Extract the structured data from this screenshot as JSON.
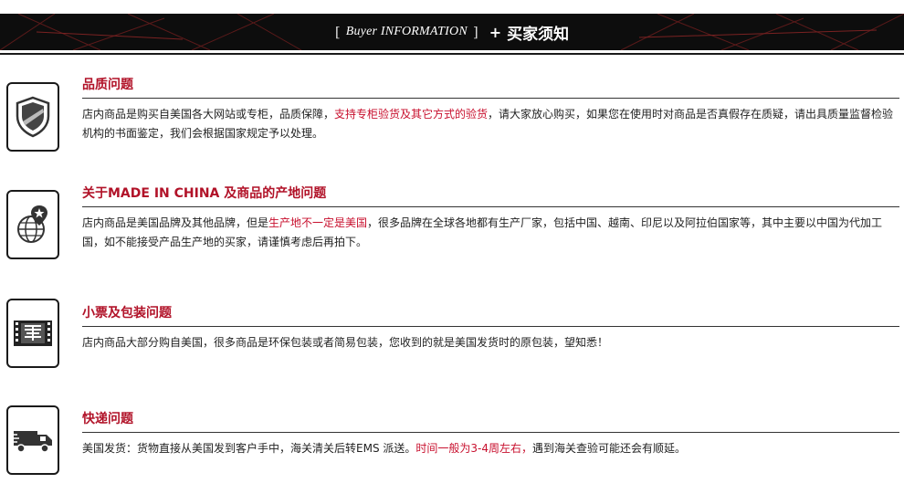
{
  "header": {
    "bracket_open": "[",
    "title_en": "Buyer INFORMATION",
    "bracket_close": "]",
    "plus": "+",
    "title_cn": "买家须知"
  },
  "colors": {
    "accent": "#b11228",
    "highlight": "#c8102e",
    "banner": "#0d0d0d"
  },
  "sections": [
    {
      "icon": "shield-icon",
      "title": "品质问题",
      "body_before": "店内商品是购买自美国各大网站或专柜，品质保障，",
      "body_highlight": "支持专柜验货及其它方式的验货",
      "body_after": "，请大家放心购买，如果您在使用时对商品是否真假存在质疑，请出具质量监督检验机构的书面鉴定，我们会根据国家规定予以处理。"
    },
    {
      "icon": "globe-location-icon",
      "title": "关于MADE IN CHINA 及商品的产地问题",
      "body_before": "店内商品是美国品牌及其他品牌，但是",
      "body_highlight": "生产地不一定是美国",
      "body_after": "，很多品牌在全球各地都有生产厂家，包括中国、越南、印尼以及阿拉伯国家等，其中主要以中国为代加工国，如不能接受产品生产地的买家，请谨慎考虑后再拍下。"
    },
    {
      "icon": "receipt-film-icon",
      "title": "小票及包装问题",
      "body_before": "店内商品大部分购自美国，很多商品是环保包装或者简易包装，您收到的就是美国发货时的原包装，望知悉！",
      "body_highlight": "",
      "body_after": ""
    },
    {
      "icon": "delivery-truck-icon",
      "title": "快递问题",
      "body_before": "美国发货：货物直接从美国发到客户手中，海关清关后转EMS 派送。",
      "body_highlight": "时间一般为3-4周左右，",
      "body_after": "遇到海关查验可能还会有顺延。"
    }
  ]
}
